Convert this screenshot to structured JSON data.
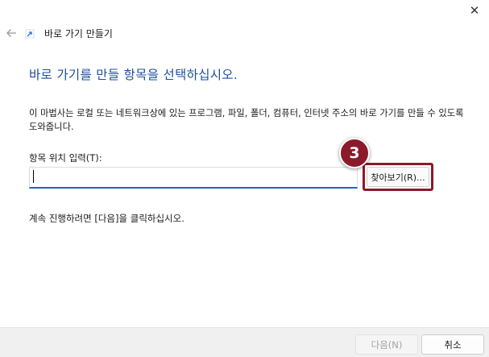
{
  "window": {
    "close_glyph": "✕"
  },
  "nav": {
    "back_icon": "arrow-left-icon",
    "wizard_icon": "shortcut-wizard-icon",
    "title": "바로 가기 만들기"
  },
  "main": {
    "heading": "바로 가기를 만들 항목을 선택하십시오.",
    "description": "이 마법사는 로컬 또는 네트워크상에 있는 프로그램, 파일, 폴더, 컴퓨터, 인터넷 주소의 바로 가기를 만들 수 있도록 도와줍니다.",
    "location_label": "항목 위치 입력(T):",
    "location_value": "",
    "browse_label": "찾아보기(R)...",
    "continue_hint": "계속 진행하려면 [다음]을 클릭하십시오."
  },
  "annotation": {
    "step_number": "3",
    "color": "#8b1a2b"
  },
  "footer": {
    "next_label": "다음(N)",
    "cancel_label": "취소"
  },
  "colors": {
    "heading": "#1e4f9c",
    "input_focus": "#1e66c8"
  }
}
